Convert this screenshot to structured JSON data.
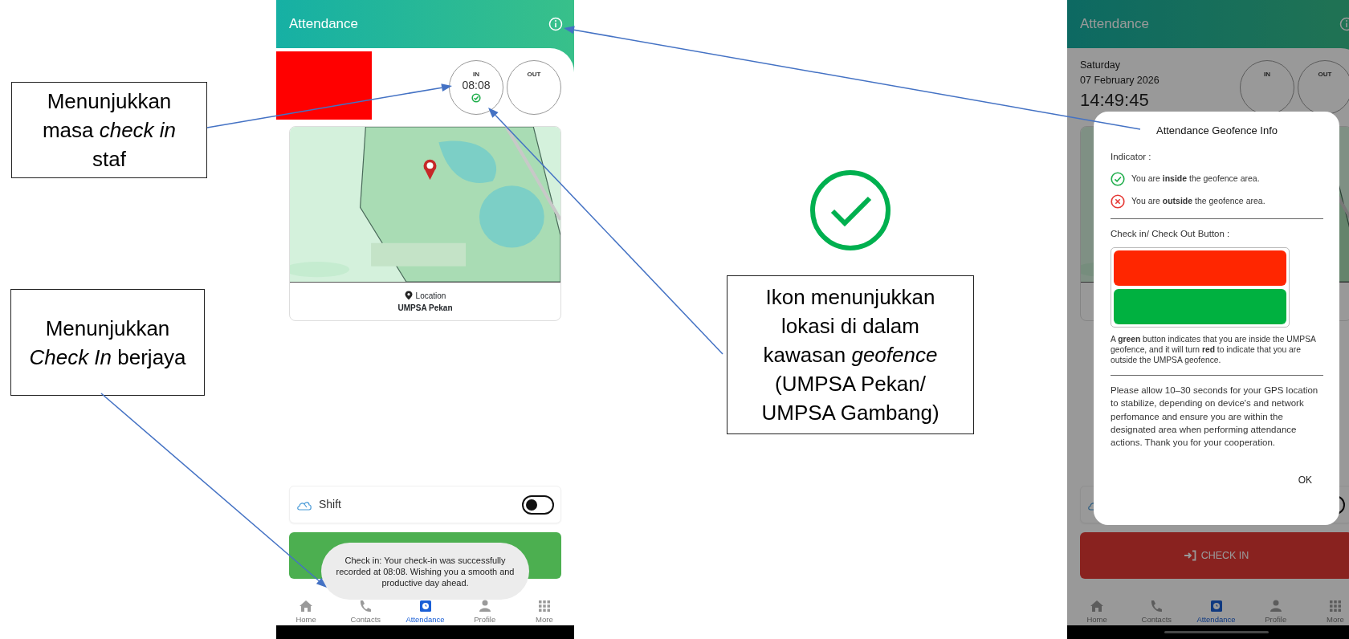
{
  "annotations": [
    {
      "text": "Menunjukkan masa *check in* staf"
    },
    {
      "text": "Menunjukkan *Check In* berjaya"
    },
    {
      "text": "Ikon menunjukkan lokasi di dalam kawasan *geofence* (UMPSA Pekan/ UMPSA Gambang)"
    }
  ],
  "left_screen": {
    "title": "Attendance",
    "punches": [
      {
        "label": "IN",
        "time": "08:08",
        "inside_geofence": true
      },
      {
        "label": "OUT"
      }
    ],
    "location": {
      "label": "Location",
      "value": "UMPSA Pekan"
    },
    "shift": {
      "label": "Shift",
      "on": false
    },
    "action_button": {
      "inside_geofence": true
    },
    "toast": "Check in: Your check-in was successfully recorded at 08:08. Wishing you a smooth and productive day ahead.",
    "nav": [
      {
        "kind": "home",
        "label": "Home",
        "selected": false
      },
      {
        "kind": "contacts",
        "label": "Contacts",
        "selected": false
      },
      {
        "kind": "attendance",
        "label": "Attendance",
        "selected": true
      },
      {
        "kind": "profile",
        "label": "Profile",
        "selected": false
      },
      {
        "kind": "more",
        "label": "More",
        "selected": false
      }
    ]
  },
  "right_screen": {
    "title": "Attendance",
    "day": "Saturday",
    "date": "07 February 2026",
    "clock": "14:49:45",
    "punches": [
      {
        "label": "IN"
      },
      {
        "label": "OUT"
      }
    ],
    "shift": {
      "on": false
    },
    "action_button": {
      "inside_geofence": false,
      "label": "CHECK IN"
    },
    "nav": [
      {
        "kind": "home",
        "label": "Home",
        "selected": false
      },
      {
        "kind": "contacts",
        "label": "Contacts",
        "selected": false
      },
      {
        "kind": "attendance",
        "label": "Attendance",
        "selected": true
      },
      {
        "kind": "profile",
        "label": "Profile",
        "selected": false
      },
      {
        "kind": "more",
        "label": "More",
        "selected": false
      }
    ],
    "dialog": {
      "title": "Attendance Geofence Info",
      "indicator_label": "Indicator :",
      "indicators": [
        {
          "kind": "inside",
          "text": "You are **inside** the geofence area."
        },
        {
          "kind": "outside",
          "text": "You are **outside** the geofence area."
        }
      ],
      "button_label": "Check in/ Check Out Button :",
      "swatches": [
        {
          "color": "#ff2600"
        },
        {
          "color": "#00b140"
        }
      ],
      "legend_text": "A **green** button indicates that you are inside the UMPSA geofence, and it will turn **red** to indicate that you are outside the UMPSA geofence.",
      "note": "Please allow 10–30 seconds for your GPS location to stabilize, depending on device's and network perfomance and ensure you are within the designated area when performing attendance actions. Thank you for your cooperation.",
      "ok_button": "OK"
    }
  }
}
